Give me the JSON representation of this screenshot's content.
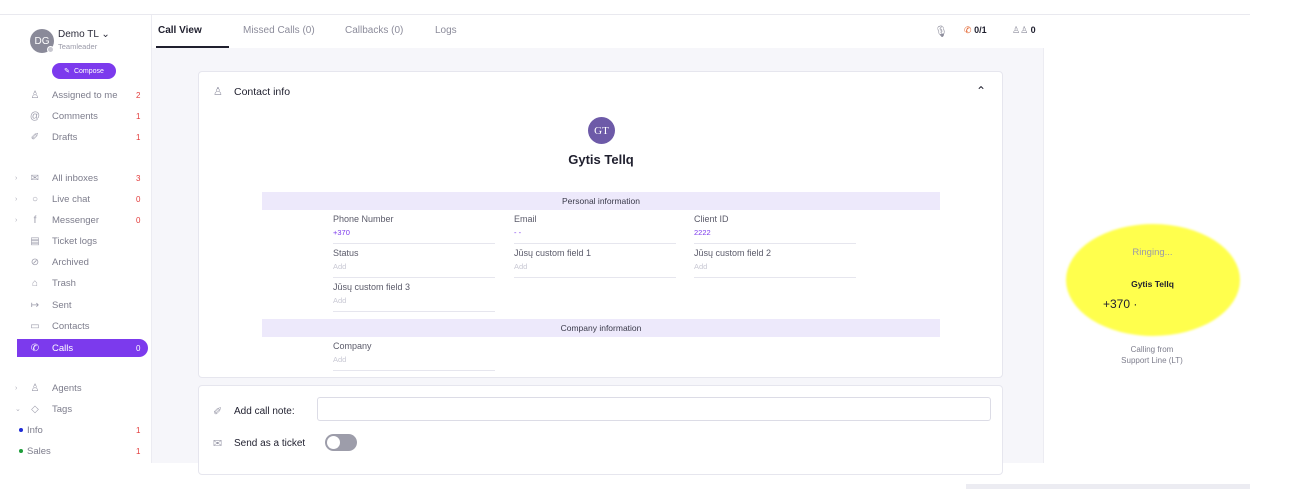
{
  "user": {
    "initials": "DG",
    "name": "Demo TL ⌄",
    "role": "Teamleader"
  },
  "compose_label": "Compose",
  "nav": {
    "assigned": {
      "label": "Assigned to me",
      "count": "2"
    },
    "comments": {
      "label": "Comments",
      "count": "1"
    },
    "drafts": {
      "label": "Drafts",
      "count": "1"
    },
    "all_inboxes": {
      "label": "All inboxes",
      "count": "3"
    },
    "live_chat": {
      "label": "Live chat",
      "count": "0"
    },
    "messenger": {
      "label": "Messenger",
      "count": "0"
    },
    "ticket_logs": {
      "label": "Ticket logs"
    },
    "archived": {
      "label": "Archived"
    },
    "trash": {
      "label": "Trash"
    },
    "sent": {
      "label": "Sent"
    },
    "contacts": {
      "label": "Contacts"
    },
    "calls": {
      "label": "Calls",
      "count": "0"
    },
    "agents": {
      "label": "Agents"
    },
    "tags": {
      "label": "Tags"
    },
    "tag_info": {
      "label": "Info",
      "count": "1",
      "color": "#1e2bd6"
    },
    "tag_sales": {
      "label": "Sales",
      "count": "1",
      "color": "#1f9d3a"
    }
  },
  "tabs": {
    "call_view": "Call View",
    "missed_calls": "Missed Calls (0)",
    "callbacks": "Callbacks (0)",
    "logs": "Logs"
  },
  "top_icons": {
    "calls_count": "0/1",
    "agents_count": "0"
  },
  "contact": {
    "section_title": "Contact info",
    "initials": "GT",
    "name": "Gytis Tellq",
    "personal_header": "Personal information",
    "company_header": "Company information",
    "fields": {
      "phone": {
        "label": "Phone Number",
        "value": "+370"
      },
      "email": {
        "label": "Email",
        "value": "-            -"
      },
      "client_id": {
        "label": "Client ID",
        "value": "2222"
      },
      "status": {
        "label": "Status",
        "value": "Add"
      },
      "custom1": {
        "label": "Jūsų custom field 1",
        "value": "Add"
      },
      "custom2": {
        "label": "Jūsų custom field 2",
        "value": "Add"
      },
      "custom3": {
        "label": "Jūsų custom field 3",
        "value": "Add"
      },
      "company": {
        "label": "Company",
        "value": "Add"
      }
    }
  },
  "call_note": {
    "label": "Add call note:",
    "value": ""
  },
  "send_ticket": {
    "label": "Send as a ticket",
    "enabled": false
  },
  "call_panel": {
    "status": "Ringing...",
    "name": "Gytis Tellq",
    "number": "+370 ·",
    "calling_from_line1": "Calling from",
    "calling_from_line2": "Support Line (LT)"
  },
  "colors": {
    "accent": "#7c3aed",
    "highlight": "#ffff44",
    "badge": "#e23a3a"
  }
}
